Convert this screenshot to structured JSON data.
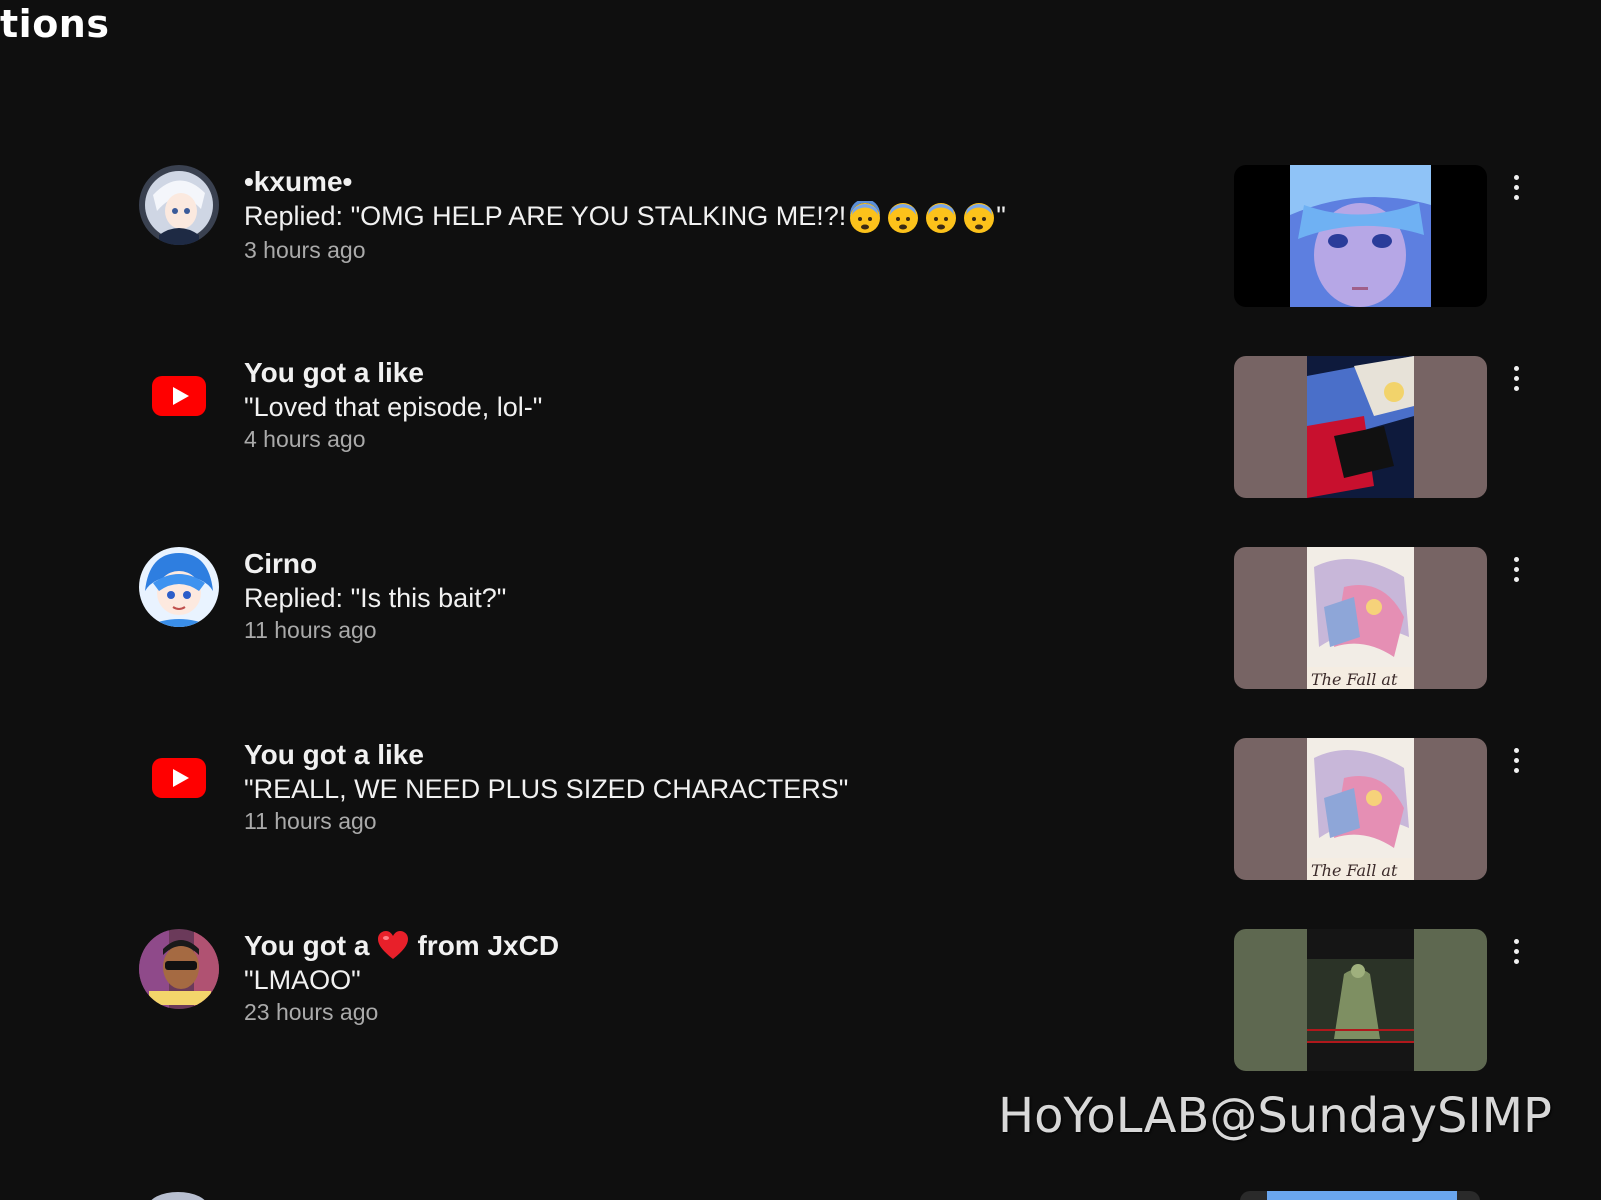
{
  "page": {
    "title": "tions"
  },
  "colors": {
    "background": "#0f0f0f",
    "text_primary": "#f1f1f1",
    "text_secondary": "#aaaaaa",
    "youtube_red": "#ff0000"
  },
  "notifications": [
    {
      "avatar": "anime-avatar-white-hair",
      "title": "•kxume•",
      "body": "Replied: \"OMG HELP ARE YOU STALKING ME!?!",
      "body_emoji": "fearful-face-emoji x4",
      "body_suffix": "\"",
      "time": "3 hours ago",
      "thumbnail": "anime-girl-blue-hair"
    },
    {
      "avatar": "youtube-icon",
      "title": "You got a like",
      "body": "\"Loved that episode, lol-\"",
      "time": "4 hours ago",
      "thumbnail": "anime-action-red-blue"
    },
    {
      "avatar": "anime-avatar-blue-hair",
      "title": "Cirno",
      "body": "Replied: \"Is this bait?\"",
      "time": "11 hours ago",
      "thumbnail": "the-fall-poster"
    },
    {
      "avatar": "youtube-icon",
      "title": "You got a like",
      "body": "\"REALL, WE NEED PLUS SIZED CHARACTERS\"",
      "time": "11 hours ago",
      "thumbnail": "the-fall-poster"
    },
    {
      "avatar": "person-sunglasses-avatar",
      "title_prefix": "You got a",
      "title_icon": "red-heart-icon",
      "title_suffix": "from JxCD",
      "body": "\"LMAOO\"",
      "time": "23 hours ago",
      "thumbnail": "dark-game-scene"
    }
  ],
  "watermark": "HoYoLAB@SundaySIMP"
}
